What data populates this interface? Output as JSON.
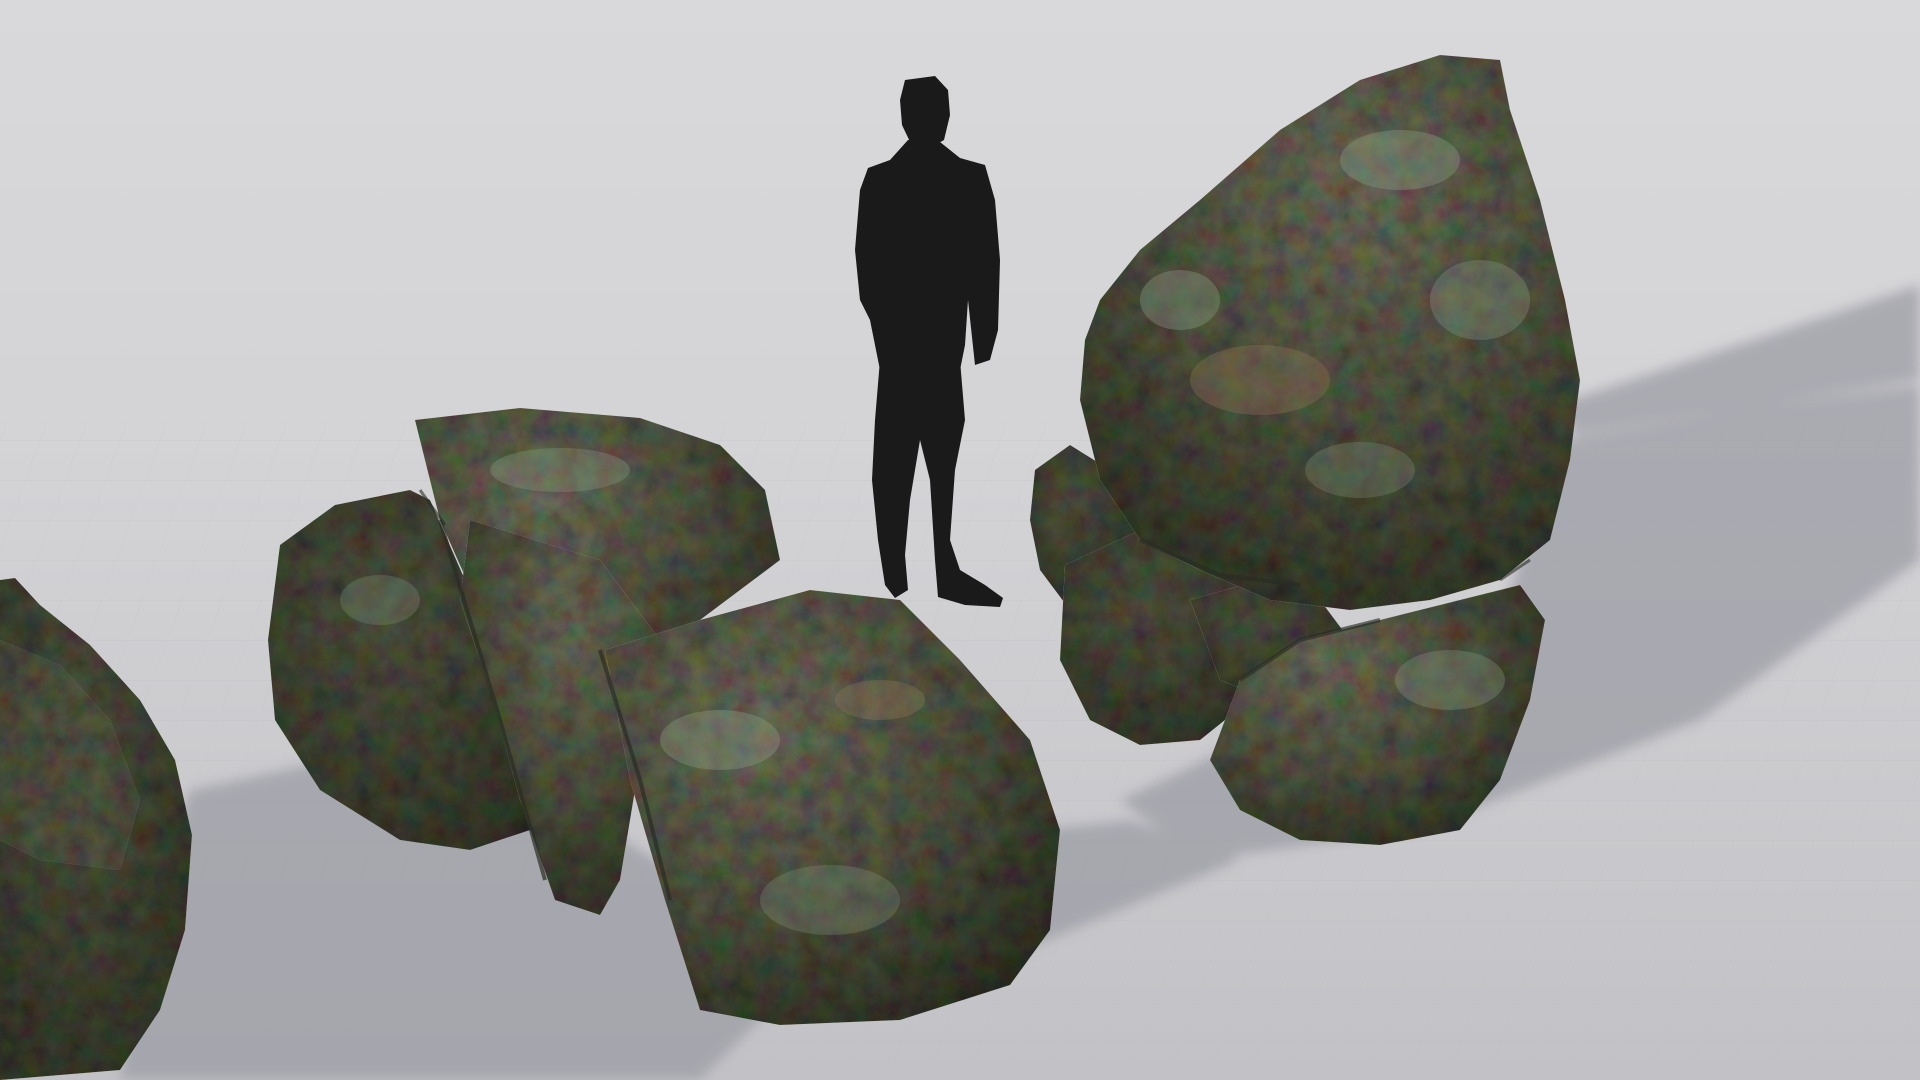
{
  "scene": {
    "objects": [
      {
        "name": "human-scale-silhouette",
        "kind": "silhouette"
      },
      {
        "name": "split-boulder-cluster",
        "kind": "rock"
      },
      {
        "name": "tall-boulder",
        "kind": "rock"
      },
      {
        "name": "partial-boulder-left",
        "kind": "rock"
      }
    ]
  },
  "colors": {
    "sky_top": "#d9d9db",
    "sky_mid": "#d3d3d6",
    "ground": "#cbcbce",
    "ground_near": "#c2c2c6",
    "grid_line": "#b9b9bd",
    "shadow": "#9c9ca5",
    "silhouette": "#1a1a1a",
    "rock_dark": "#3e4236",
    "rock_mid": "#6b6d5d",
    "rock_light": "#8f8e80",
    "lichen_green": "#8fa38c",
    "lichen_orange": "#9a7e5e"
  }
}
